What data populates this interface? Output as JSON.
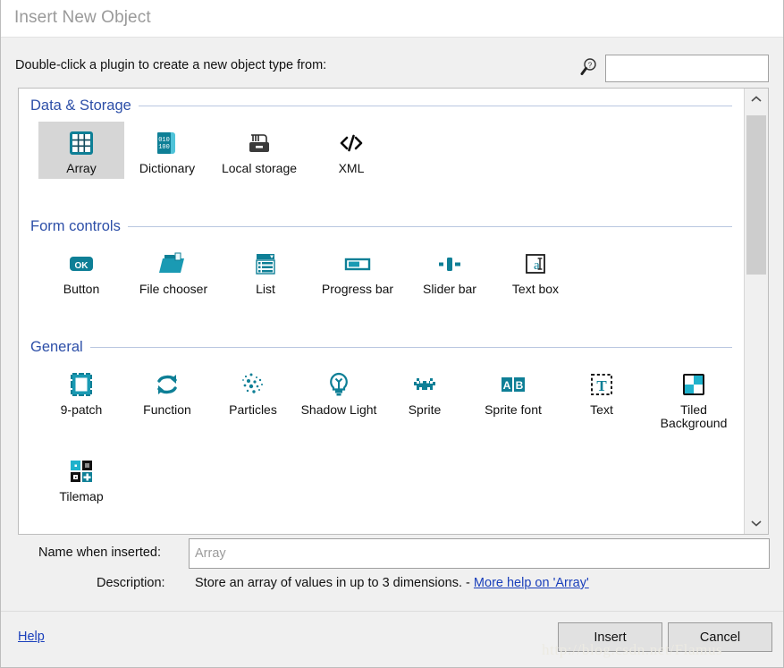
{
  "window": {
    "title": "Insert New Object"
  },
  "header": {
    "prompt": "Double-click a plugin to create a new object type from:",
    "search_icon": "search-help-icon",
    "search_value": "",
    "search_placeholder": ""
  },
  "colors": {
    "accent_teal": "#0e7f96",
    "accent_teal_dark": "#116073",
    "section_header_blue": "#2d4fa8",
    "link_blue": "#1a3fbb",
    "selection_gray": "#d6d6d6",
    "dialog_bg": "#f0f0f0",
    "panel_bg": "#ffffff"
  },
  "panel": {
    "sections": [
      {
        "title": "Data & Storage",
        "items": [
          {
            "label": "Array",
            "icon": "array-grid-icon",
            "selected": true
          },
          {
            "label": "Dictionary",
            "icon": "dictionary-book-icon",
            "selected": false
          },
          {
            "label": "Local storage",
            "icon": "local-storage-disk-icon",
            "selected": false
          },
          {
            "label": "XML",
            "icon": "xml-code-brackets-icon",
            "selected": false
          }
        ]
      },
      {
        "title": "Form controls",
        "items": [
          {
            "label": "Button",
            "icon": "button-ok-icon",
            "selected": false
          },
          {
            "label": "File chooser",
            "icon": "file-folder-icon",
            "selected": false
          },
          {
            "label": "List",
            "icon": "list-dropdown-icon",
            "selected": false
          },
          {
            "label": "Progress bar",
            "icon": "progress-bar-icon",
            "selected": false
          },
          {
            "label": "Slider bar",
            "icon": "slider-bar-icon",
            "selected": false
          },
          {
            "label": "Text box",
            "icon": "text-box-icon",
            "selected": false
          }
        ]
      },
      {
        "title": "General",
        "items": [
          {
            "label": "9-patch",
            "icon": "nine-patch-icon",
            "selected": false
          },
          {
            "label": "Function",
            "icon": "function-arrows-icon",
            "selected": false
          },
          {
            "label": "Particles",
            "icon": "particles-dots-icon",
            "selected": false
          },
          {
            "label": "Shadow Light",
            "icon": "shadow-light-bulb-icon",
            "selected": false
          },
          {
            "label": "Sprite",
            "icon": "sprite-invader-icon",
            "selected": false
          },
          {
            "label": "Sprite font",
            "icon": "sprite-font-ab-icon",
            "selected": false
          },
          {
            "label": "Text",
            "icon": "text-dashed-t-icon",
            "selected": false
          },
          {
            "label": "Tiled Background",
            "icon": "tiled-background-icon",
            "selected": false
          },
          {
            "label": "Tilemap",
            "icon": "tilemap-icon",
            "selected": false
          }
        ]
      }
    ]
  },
  "scrollbar": {
    "up_arrow": "chevron-up-icon",
    "down_arrow": "chevron-down-icon"
  },
  "form": {
    "name_label": "Name when inserted:",
    "name_value": "Array",
    "description_label": "Description:",
    "description_text": "Store an array of values in up to 3 dimensions. -",
    "description_link": "More help on 'Array'"
  },
  "footer": {
    "help_label": "Help",
    "insert_label": "Insert",
    "cancel_label": "Cancel"
  },
  "watermark": {
    "text": "http://blog.csdn.net/Flamus"
  }
}
